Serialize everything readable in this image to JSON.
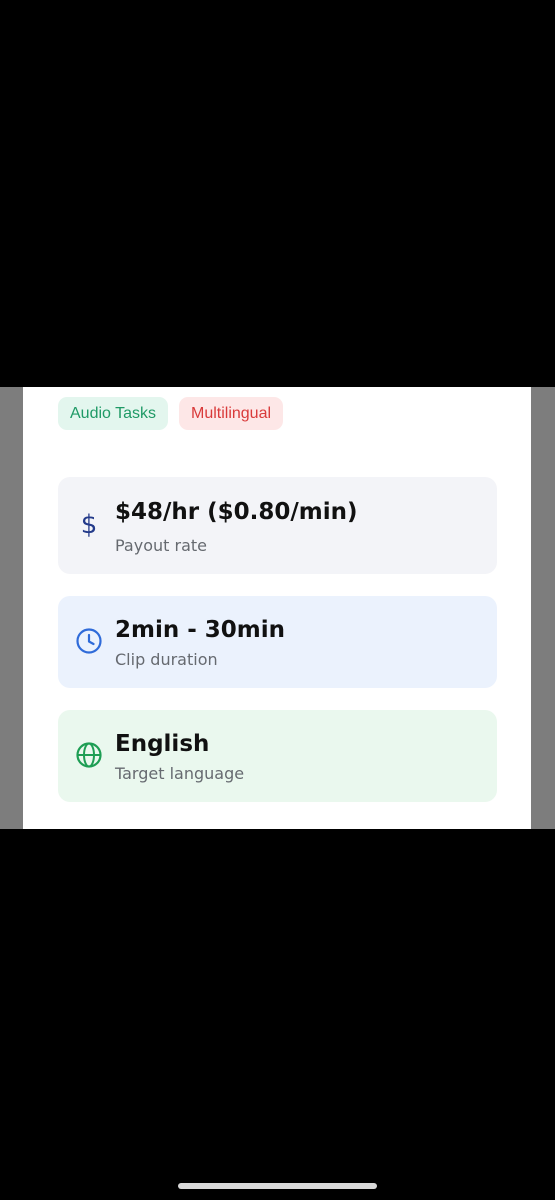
{
  "tags": [
    {
      "label": "Audio Tasks",
      "color": "#1f9a66",
      "background": "#e3f6ee"
    },
    {
      "label": "Multilingual",
      "color": "#d93a3a",
      "background": "#fde7e7"
    }
  ],
  "info_rows": [
    {
      "icon": "dollar-icon",
      "title": "$48/hr ($0.80/min)",
      "subtitle": "Payout rate",
      "icon_color": "#233a8a"
    },
    {
      "icon": "clock-icon",
      "title": "2min - 30min",
      "subtitle": "Clip duration",
      "icon_color": "#2f6bd9"
    },
    {
      "icon": "globe-icon",
      "title": "English",
      "subtitle": "Target language",
      "icon_color": "#1e9e54"
    }
  ],
  "icons": {
    "dollar_glyph": "$"
  }
}
